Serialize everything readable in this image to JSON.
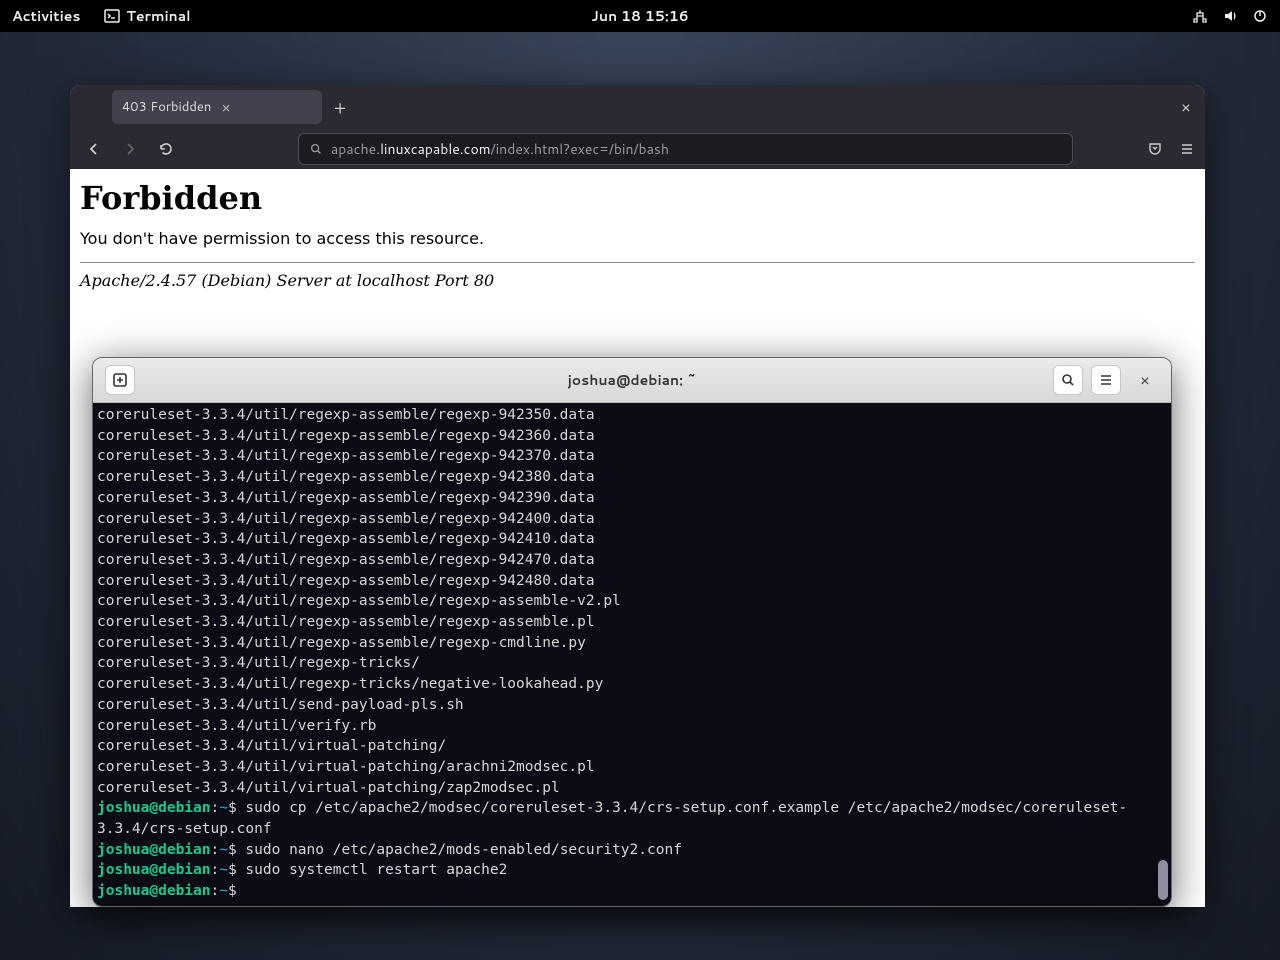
{
  "topbar": {
    "activities": "Activities",
    "terminal": "Terminal",
    "clock": "Jun 18  15:16"
  },
  "browser": {
    "tab_title": "403 Forbidden",
    "url_pre": "apache.",
    "url_host": "linuxcapable.com",
    "url_rest": "/index.html?exec=/bin/bash",
    "page_heading": "Forbidden",
    "page_message": "You don't have permission to access this resource.",
    "server_line": "Apache/2.4.57 (Debian) Server at localhost Port 80"
  },
  "terminal": {
    "title": "joshua@debian: ~",
    "prompt_user": "joshua@debian",
    "prompt_sep": ":",
    "prompt_path": "~",
    "prompt_char": "$",
    "output_lines": [
      "coreruleset-3.3.4/util/regexp-assemble/regexp-942350.data",
      "coreruleset-3.3.4/util/regexp-assemble/regexp-942360.data",
      "coreruleset-3.3.4/util/regexp-assemble/regexp-942370.data",
      "coreruleset-3.3.4/util/regexp-assemble/regexp-942380.data",
      "coreruleset-3.3.4/util/regexp-assemble/regexp-942390.data",
      "coreruleset-3.3.4/util/regexp-assemble/regexp-942400.data",
      "coreruleset-3.3.4/util/regexp-assemble/regexp-942410.data",
      "coreruleset-3.3.4/util/regexp-assemble/regexp-942470.data",
      "coreruleset-3.3.4/util/regexp-assemble/regexp-942480.data",
      "coreruleset-3.3.4/util/regexp-assemble/regexp-assemble-v2.pl",
      "coreruleset-3.3.4/util/regexp-assemble/regexp-assemble.pl",
      "coreruleset-3.3.4/util/regexp-assemble/regexp-cmdline.py",
      "coreruleset-3.3.4/util/regexp-tricks/",
      "coreruleset-3.3.4/util/regexp-tricks/negative-lookahead.py",
      "coreruleset-3.3.4/util/send-payload-pls.sh",
      "coreruleset-3.3.4/util/verify.rb",
      "coreruleset-3.3.4/util/virtual-patching/",
      "coreruleset-3.3.4/util/virtual-patching/arachni2modsec.pl",
      "coreruleset-3.3.4/util/virtual-patching/zap2modsec.pl"
    ],
    "commands": [
      "sudo cp /etc/apache2/modsec/coreruleset-3.3.4/crs-setup.conf.example /etc/apache2/modsec/coreruleset-3.3.4/crs-setup.conf",
      "sudo nano /etc/apache2/mods-enabled/security2.conf",
      "sudo systemctl restart apache2",
      ""
    ]
  }
}
